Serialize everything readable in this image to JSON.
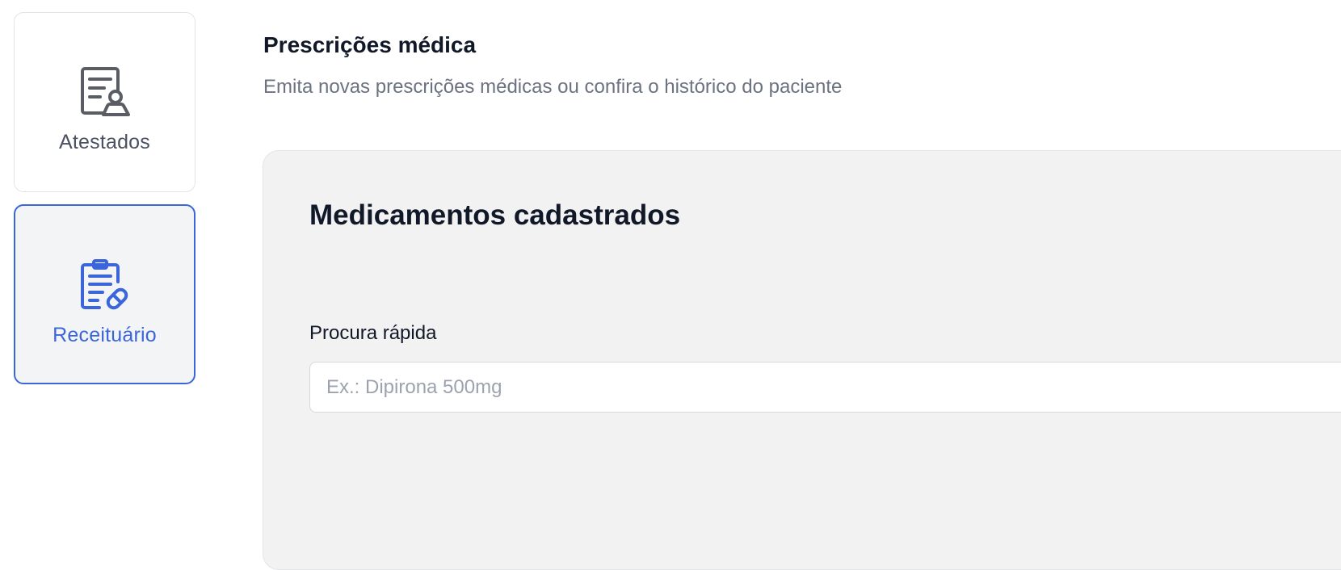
{
  "sidebar": {
    "items": [
      {
        "label": "Atestados",
        "icon": "medical-certificate-icon",
        "active": false
      },
      {
        "label": "Receituário",
        "icon": "prescription-clipboard-icon",
        "active": true
      }
    ]
  },
  "header": {
    "title": "Prescrições médica",
    "subtitle": "Emita novas prescrições médicas ou confira o histórico do paciente"
  },
  "panel": {
    "title": "Medicamentos cadastrados",
    "search": {
      "label": "Procura rápida",
      "value": "",
      "placeholder": "Ex.: Dipirona 500mg"
    }
  },
  "colors": {
    "accent": "#3b66db",
    "icon_inactive": "#5a5d63",
    "panel_bg": "#f2f2f3",
    "text_primary": "#111827",
    "text_muted": "#6b7280"
  }
}
